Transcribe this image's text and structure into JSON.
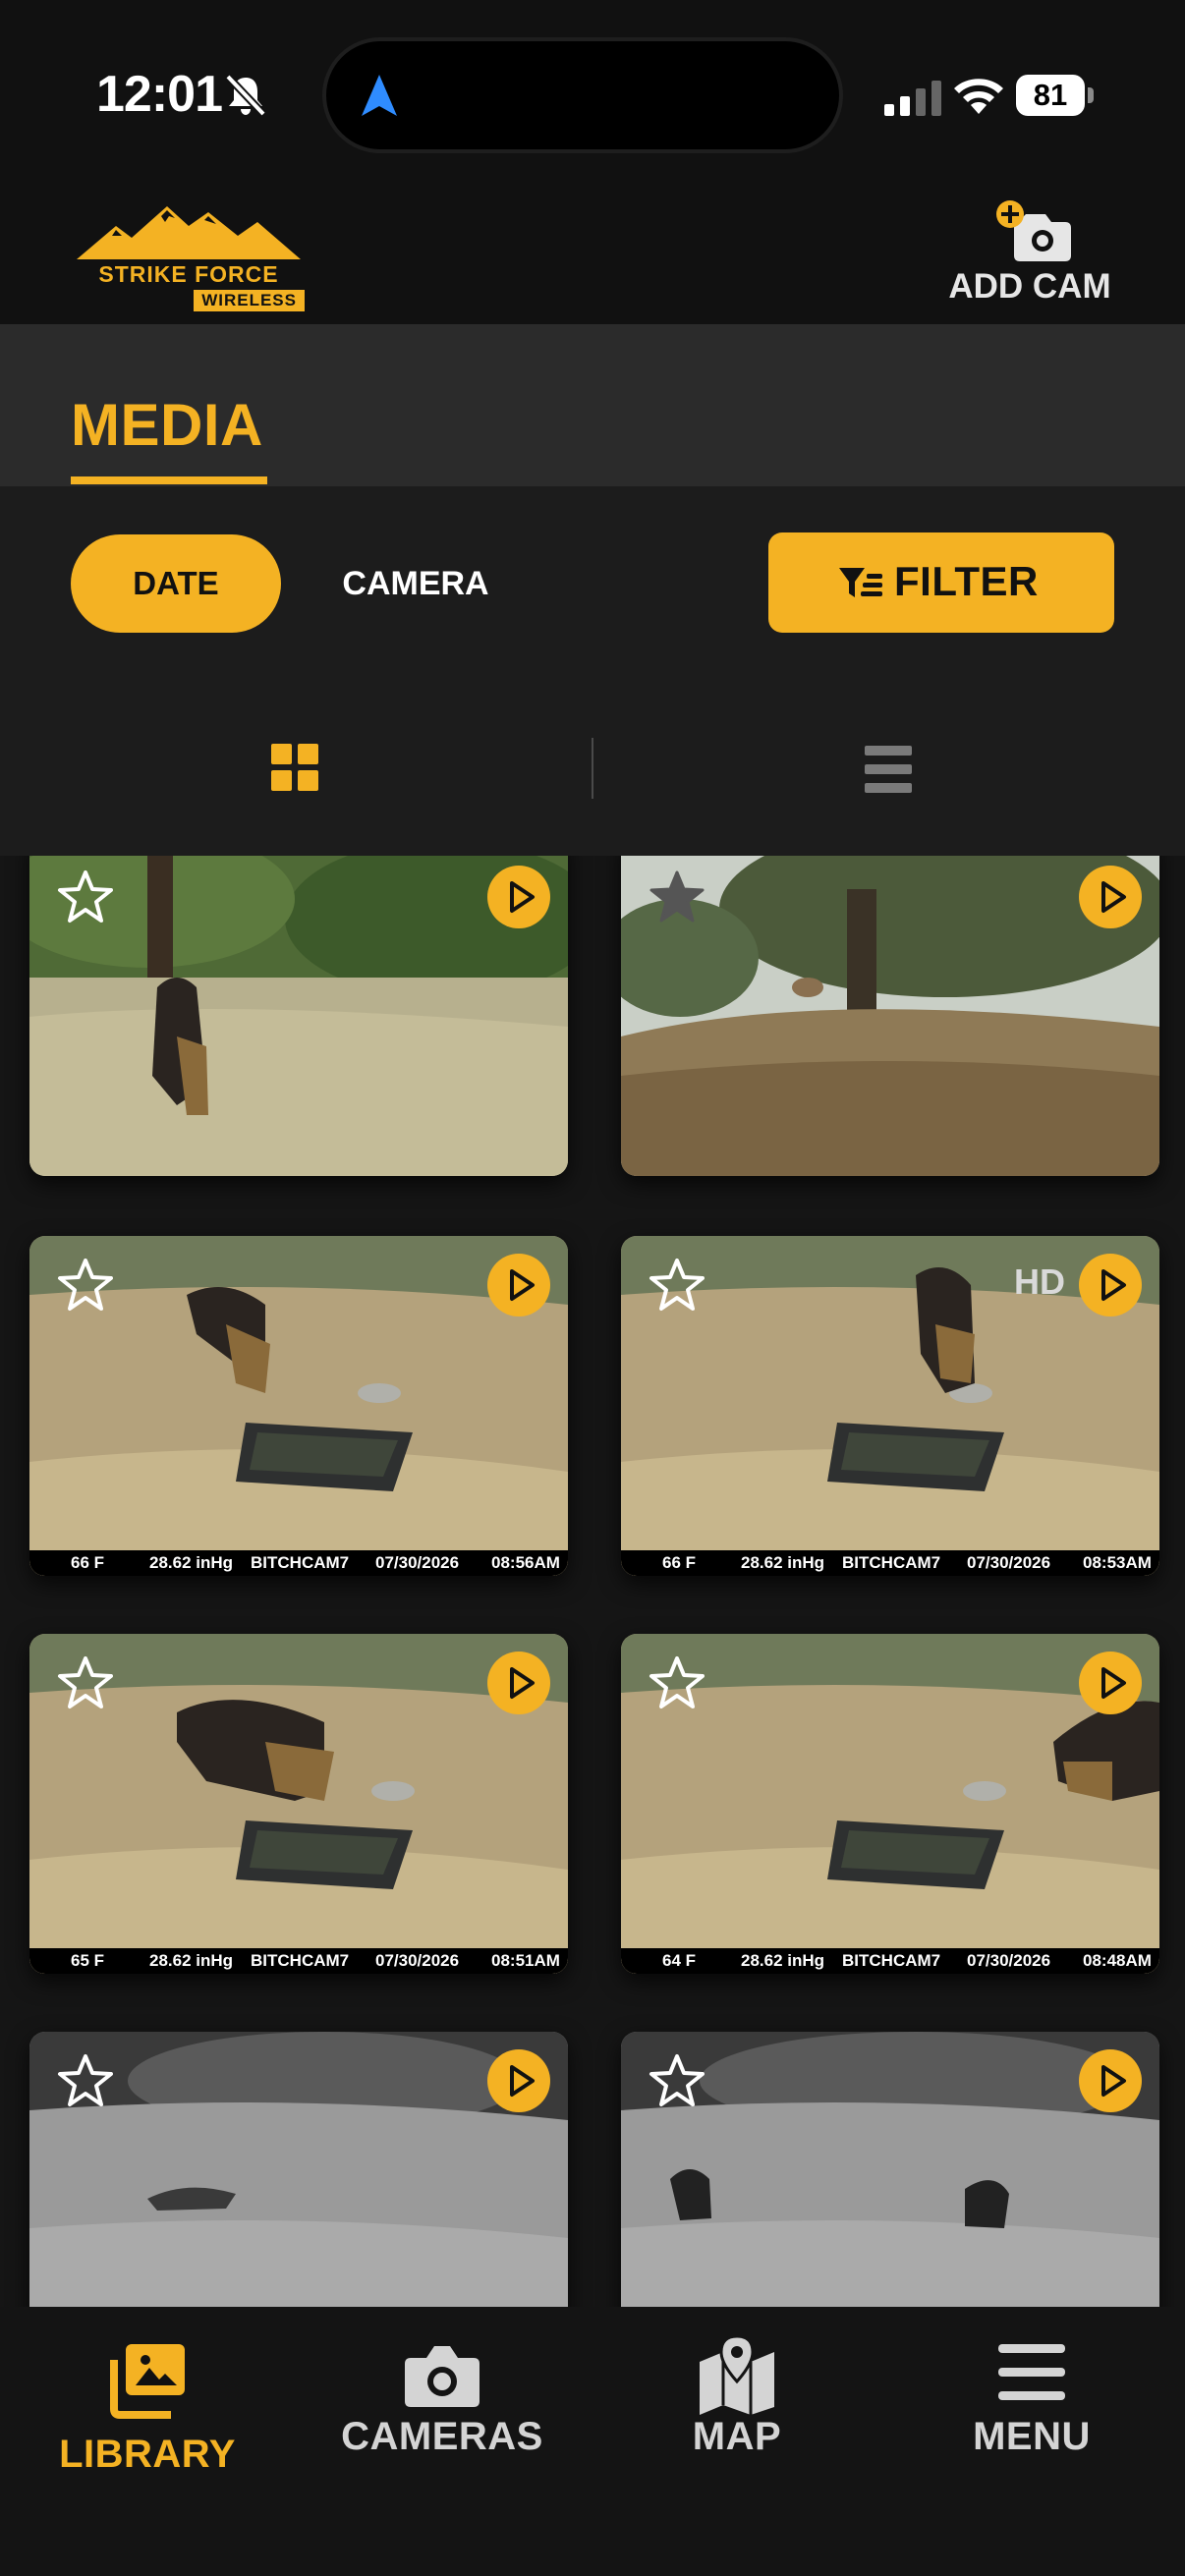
{
  "status_bar": {
    "time": "12:01",
    "battery": "81"
  },
  "header": {
    "logo_brand": "STRIKE FORCE",
    "logo_sub": "WIRELESS",
    "add_cam_label": "ADD CAM"
  },
  "media": {
    "title": "MEDIA",
    "sort_date": "DATE",
    "sort_camera": "CAMERA",
    "filter_label": "FILTER"
  },
  "colors": {
    "accent": "#F4B223",
    "background": "#111111",
    "band": "#2b2b2b",
    "nav_inactive": "#d4d4d4"
  },
  "thumbnails": [
    {
      "hd": "",
      "caption": null
    },
    {
      "hd": "",
      "caption": null
    },
    {
      "hd": "",
      "caption": {
        "temp": "66 F",
        "pressure": "28.62 inHg",
        "camera": "BITCHCAM7",
        "date": "07/30/2026",
        "time": "08:56AM"
      }
    },
    {
      "hd": "HD",
      "caption": {
        "temp": "66 F",
        "pressure": "28.62 inHg",
        "camera": "BITCHCAM7",
        "date": "07/30/2026",
        "time": "08:53AM"
      }
    },
    {
      "hd": "",
      "caption": {
        "temp": "65 F",
        "pressure": "28.62 inHg",
        "camera": "BITCHCAM7",
        "date": "07/30/2026",
        "time": "08:51AM"
      }
    },
    {
      "hd": "",
      "caption": {
        "temp": "64 F",
        "pressure": "28.62 inHg",
        "camera": "BITCHCAM7",
        "date": "07/30/2026",
        "time": "08:48AM"
      }
    },
    {
      "hd": "",
      "caption": null
    },
    {
      "hd": "",
      "caption": null
    }
  ],
  "bottom_nav": {
    "library": "LIBRARY",
    "cameras": "CAMERAS",
    "map": "MAP",
    "menu": "MENU"
  }
}
